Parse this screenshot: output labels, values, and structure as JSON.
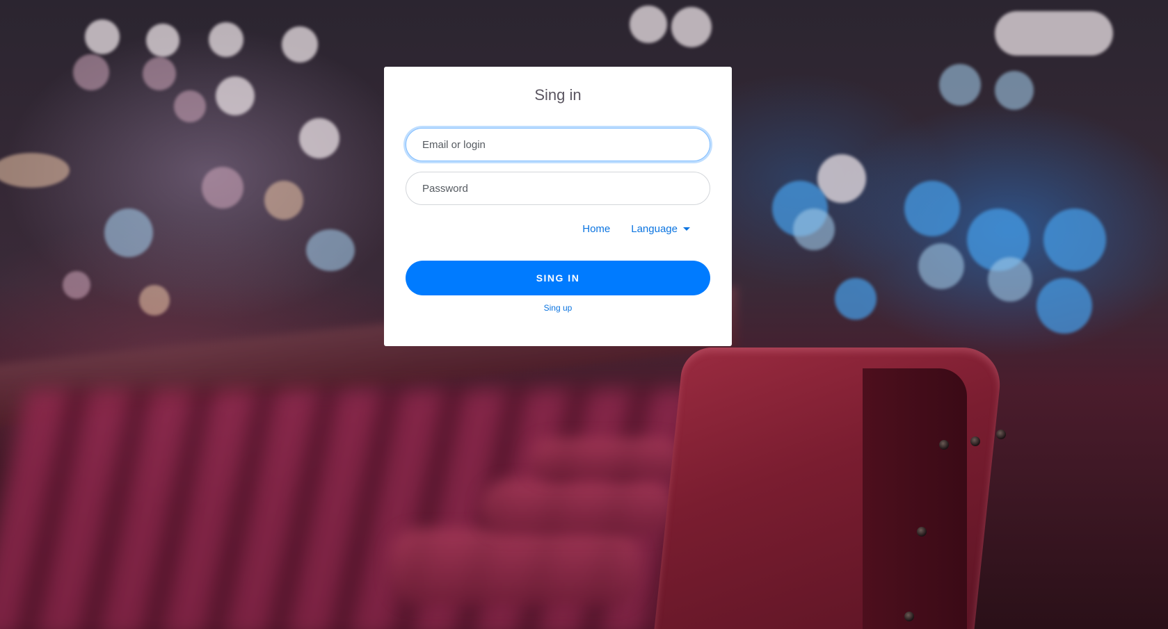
{
  "login": {
    "title": "Sing in",
    "email_placeholder": "Email or login",
    "password_placeholder": "Password",
    "home_link": "Home",
    "language_link": "Language",
    "submit_label": "SING IN",
    "signup_link": "Sing up"
  },
  "colors": {
    "primary": "#007bff",
    "link": "#0b74e0",
    "card_background": "#ffffff"
  }
}
